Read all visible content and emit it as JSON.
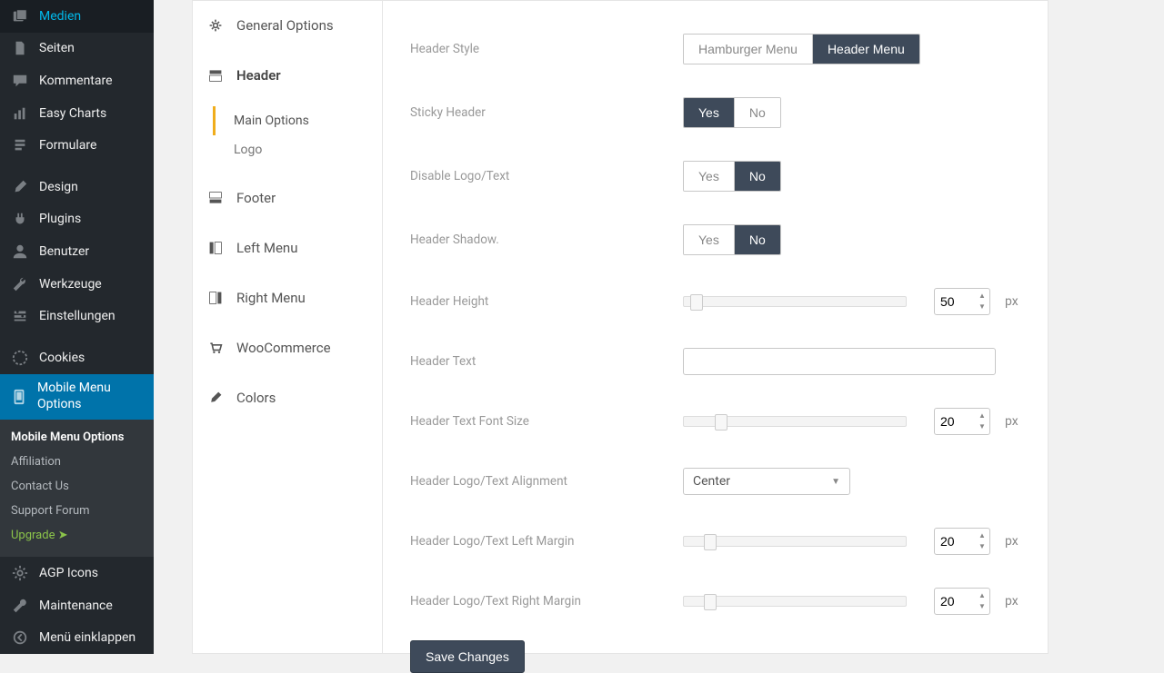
{
  "wp_sidebar": {
    "items": [
      {
        "label": "Medien",
        "icon": "media-icon"
      },
      {
        "label": "Seiten",
        "icon": "page-icon"
      },
      {
        "label": "Kommentare",
        "icon": "comment-icon"
      },
      {
        "label": "Easy Charts",
        "icon": "charts-icon"
      },
      {
        "label": "Formulare",
        "icon": "form-icon"
      },
      {
        "label": "Design",
        "icon": "brush-icon"
      },
      {
        "label": "Plugins",
        "icon": "plug-icon"
      },
      {
        "label": "Benutzer",
        "icon": "user-icon"
      },
      {
        "label": "Werkzeuge",
        "icon": "tools-icon"
      },
      {
        "label": "Einstellungen",
        "icon": "settings-icon"
      },
      {
        "label": "Cookies",
        "icon": "cookie-icon"
      },
      {
        "label": "Mobile Menu Options",
        "icon": "mobile-icon",
        "current": true
      }
    ],
    "submenu": [
      {
        "label": "Mobile Menu Options",
        "active": true
      },
      {
        "label": "Affiliation"
      },
      {
        "label": "Contact Us"
      },
      {
        "label": "Support Forum"
      },
      {
        "label": "Upgrade  ➤",
        "upgrade": true
      }
    ],
    "bottom": [
      {
        "label": "AGP Icons",
        "icon": "gear-icon"
      },
      {
        "label": "Maintenance",
        "icon": "wrench-icon"
      },
      {
        "label": "Menü einklappen",
        "icon": "collapse-icon"
      }
    ]
  },
  "settings_nav": {
    "items": [
      {
        "label": "General Options",
        "icon": "gear-icon"
      },
      {
        "label": "Header",
        "icon": "header-icon",
        "open": true,
        "sub": [
          {
            "label": "Main Options",
            "active": true
          },
          {
            "label": "Logo"
          }
        ]
      },
      {
        "label": "Footer",
        "icon": "footer-icon"
      },
      {
        "label": "Left Menu",
        "icon": "left-icon"
      },
      {
        "label": "Right Menu",
        "icon": "right-icon"
      },
      {
        "label": "WooCommerce",
        "icon": "cart-icon"
      },
      {
        "label": "Colors",
        "icon": "brush-icon"
      }
    ]
  },
  "form": {
    "header_style": {
      "label": "Header Style",
      "options": [
        "Hamburger Menu",
        "Header Menu"
      ],
      "value": "Header Menu"
    },
    "sticky_header": {
      "label": "Sticky Header",
      "options": [
        "Yes",
        "No"
      ],
      "value": "Yes"
    },
    "disable_logo": {
      "label": "Disable Logo/Text",
      "options": [
        "Yes",
        "No"
      ],
      "value": "No"
    },
    "header_shadow": {
      "label": "Header Shadow.",
      "options": [
        "Yes",
        "No"
      ],
      "value": "No"
    },
    "header_height": {
      "label": "Header Height",
      "value": 50,
      "unit": "px",
      "knob_pct": 3
    },
    "header_text": {
      "label": "Header Text",
      "value": ""
    },
    "font_size": {
      "label": "Header Text Font Size",
      "value": 20,
      "unit": "px",
      "knob_pct": 14
    },
    "alignment": {
      "label": "Header Logo/Text Alignment",
      "value": "Center"
    },
    "left_margin": {
      "label": "Header Logo/Text Left Margin",
      "value": 20,
      "unit": "px",
      "knob_pct": 9
    },
    "right_margin": {
      "label": "Header Logo/Text Right Margin",
      "value": 20,
      "unit": "px",
      "knob_pct": 9
    },
    "save_label": "Save Changes"
  },
  "colors": {
    "accent": "#0073aa",
    "toggle_on": "#3e4a5a",
    "upgrade": "#8bc34a"
  }
}
